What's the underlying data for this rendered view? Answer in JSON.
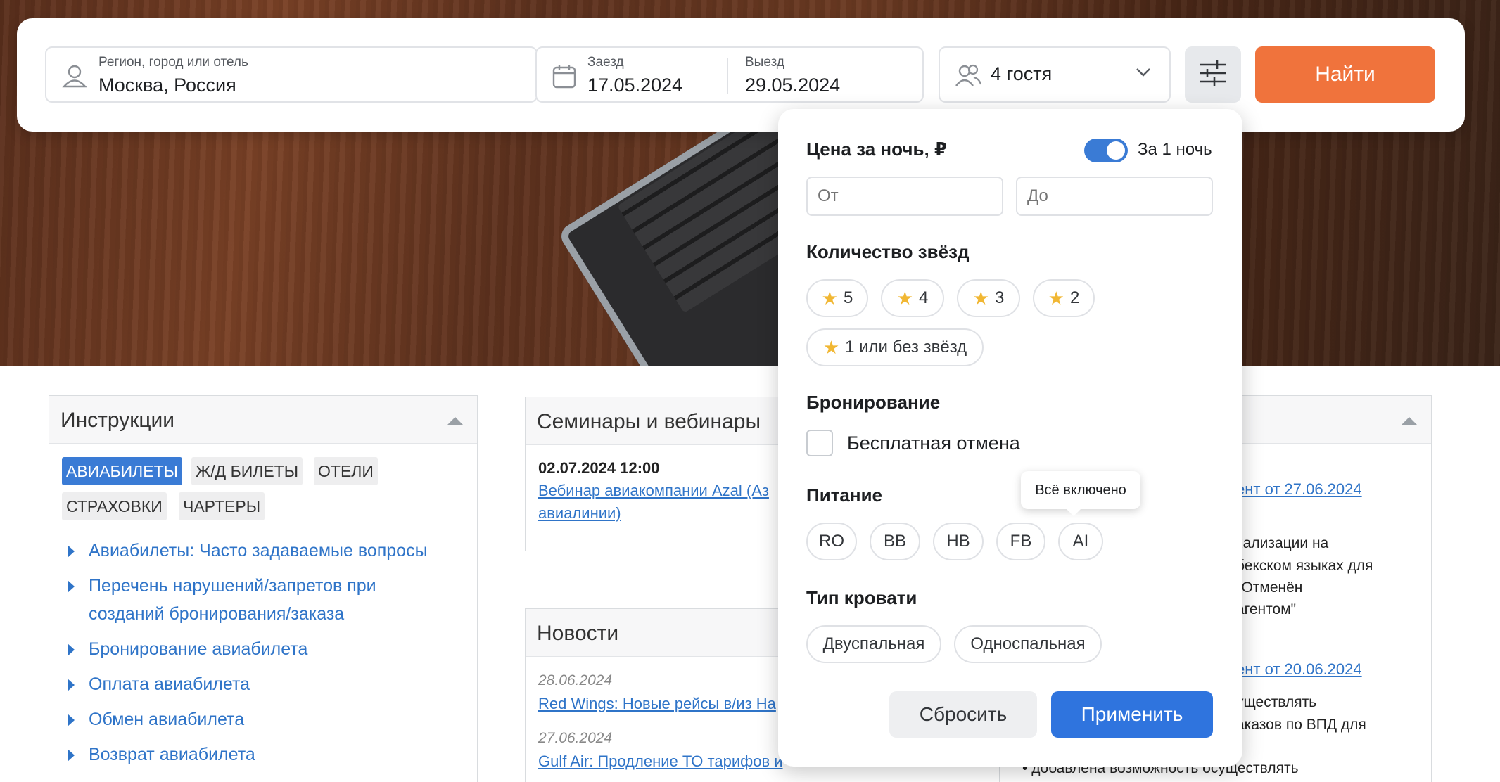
{
  "search": {
    "region_label": "Регион, город или отель",
    "region_value": "Москва, Россия",
    "checkin_label": "Заезд",
    "checkin_value": "17.05.2024",
    "checkout_label": "Выезд",
    "checkout_value": "29.05.2024",
    "guests_value": "4 гостя",
    "find_label": "Найти"
  },
  "instructions": {
    "title": "Инструкции",
    "tabs": [
      "АВИАБИЛЕТЫ",
      "Ж/Д БИЛЕТЫ",
      "ОТЕЛИ",
      "СТРАХОВКИ",
      "ЧАРТЕРЫ"
    ],
    "items": [
      "Авиабилеты: Часто задаваемые вопросы",
      "Перечень нарушений/запретов при",
      "созданий бронирования/заказа",
      "Бронирование авиабилета",
      "Оплата авиабилета",
      "Обмен авиабилета",
      "Возврат авиабилета"
    ]
  },
  "seminars": {
    "title": "Семинары и вебинары",
    "date": "02.07.2024 12:00",
    "link_line1": "Вебинар авиакомпании Azal (Аз",
    "link_line2": "авиалинии)"
  },
  "news": {
    "title": "Новости",
    "items": [
      {
        "date": "28.06.2024",
        "text": "Red Wings: Новые рейсы в/из На"
      },
      {
        "date": "27.06.2024",
        "text": "Gulf Air: Продление ТО тарифов и"
      }
    ]
  },
  "right_panel": {
    "link1": "ент от 27.06.2024",
    "text1": [
      "кализации на",
      "бекском языках для",
      "\"Отменён",
      "агентом\""
    ],
    "link2": "ент от 20.06.2024",
    "text2": [
      "уществлять",
      "аказов по ВПД для"
    ],
    "bullet": "добавлена возможность осуществлять"
  },
  "filters": {
    "price_title": "Цена за ночь, ₽",
    "per_night_label": "За 1 ночь",
    "per_night_on": true,
    "from_placeholder": "От",
    "to_placeholder": "До",
    "stars_title": "Количество звёзд",
    "stars": [
      "5",
      "4",
      "3",
      "2",
      "1 или без звёзд"
    ],
    "booking_title": "Бронирование",
    "free_cancel_label": "Бесплатная отмена",
    "meals_title": "Питание",
    "meals": [
      "RO",
      "BB",
      "HB",
      "FB",
      "AI"
    ],
    "meal_tooltip": "Всё включено",
    "bed_title": "Тип кровати",
    "beds": [
      "Двуспальная",
      "Односпальная"
    ],
    "reset_label": "Сбросить",
    "apply_label": "Применить"
  },
  "colors": {
    "accent": "#f0733c",
    "primary": "#2f74de",
    "link": "#2f74c8",
    "star": "#f1b733"
  }
}
